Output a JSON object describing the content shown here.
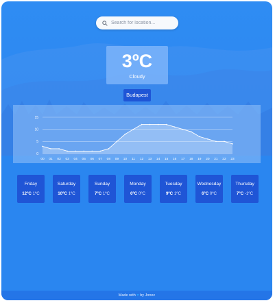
{
  "search": {
    "placeholder": "Search for location..."
  },
  "current": {
    "temperature": "3ºC",
    "condition": "Cloudy",
    "location": "Budapest"
  },
  "chart_data": {
    "type": "area",
    "x": [
      "00",
      "01",
      "02",
      "03",
      "04",
      "05",
      "06",
      "07",
      "08",
      "09",
      "10",
      "11",
      "12",
      "13",
      "14",
      "15",
      "16",
      "17",
      "18",
      "19",
      "20",
      "21",
      "22",
      "23"
    ],
    "values": [
      3,
      2,
      2,
      1,
      1,
      1,
      1,
      1,
      2,
      5,
      8,
      10,
      12,
      12,
      12,
      12,
      11,
      10,
      9,
      7,
      6,
      5,
      5,
      4
    ],
    "yticks": [
      0,
      5,
      10,
      15
    ],
    "ylim": [
      0,
      15
    ],
    "grid": true
  },
  "forecast": [
    {
      "day": "Friday",
      "high": "12ºC",
      "low": "1ºC"
    },
    {
      "day": "Saturday",
      "high": "10ºC",
      "low": "1ºC"
    },
    {
      "day": "Sunday",
      "high": "7ºC",
      "low": "1ºC"
    },
    {
      "day": "Monday",
      "high": "6ºC",
      "low": "0ºC"
    },
    {
      "day": "Tuesday",
      "high": "9ºC",
      "low": "1ºC"
    },
    {
      "day": "Wednesday",
      "high": "6ºC",
      "low": "0ºC"
    },
    {
      "day": "Thursday",
      "high": "7ºC",
      "low": "-1ºC"
    }
  ],
  "footer": {
    "made_with": "Made with",
    "by": "by Jonoc"
  },
  "colors": {
    "background": "#2a86f0",
    "card": "#1f55d6",
    "accent": "#2aa4ff"
  }
}
